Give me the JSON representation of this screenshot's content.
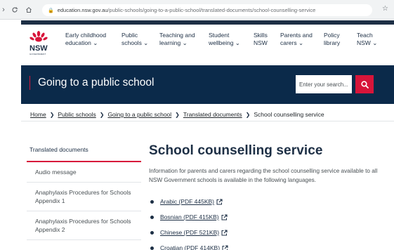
{
  "browser": {
    "url_domain": "education.nsw.gov.au",
    "url_path": "/public-schools/going-to-a-public-school/translated-documents/school-counselling-service"
  },
  "header": {
    "logo_text": "NSW",
    "logo_subtext": "GOVERNMENT",
    "menu": [
      {
        "line1": "Early childhood",
        "line2": "education ⌄"
      },
      {
        "line1": "Public",
        "line2": "schools ⌄"
      },
      {
        "line1": "Teaching and",
        "line2": "learning ⌄"
      },
      {
        "line1": "Student",
        "line2": "wellbeing ⌄"
      },
      {
        "line1": "Skills",
        "line2": "NSW"
      },
      {
        "line1": "Parents and",
        "line2": "carers ⌄"
      },
      {
        "line1": "Policy",
        "line2": "library"
      },
      {
        "line1": "Teach",
        "line2": "NSW ⌄"
      }
    ]
  },
  "banner": {
    "title": "Going to a public school",
    "search_placeholder": "Enter your search..."
  },
  "breadcrumb": [
    "Home",
    "Public schools",
    "Going to a public school",
    "Translated documents",
    "School counselling service"
  ],
  "sidebar": {
    "title": "Translated documents",
    "items": [
      "Audio message",
      "Anaphylaxis Procedures for Schools Appendix 1",
      "Anaphylaxis Procedures for Schools Appendix 2"
    ]
  },
  "main": {
    "title": "School counselling service",
    "intro": "Information for parents and carers regarding the school counselling service available to all NSW Government schools is available in the following languages.",
    "languages": [
      "Arabic (PDF 445KB)",
      "Bosnian (PDF 415KB)",
      "Chinese (PDF 521KB)",
      "Croatian (PDF 414KB)"
    ]
  },
  "colors": {
    "navy": "#1d2f45",
    "banner": "#0b2a4a",
    "accent_red": "#d7153a"
  }
}
